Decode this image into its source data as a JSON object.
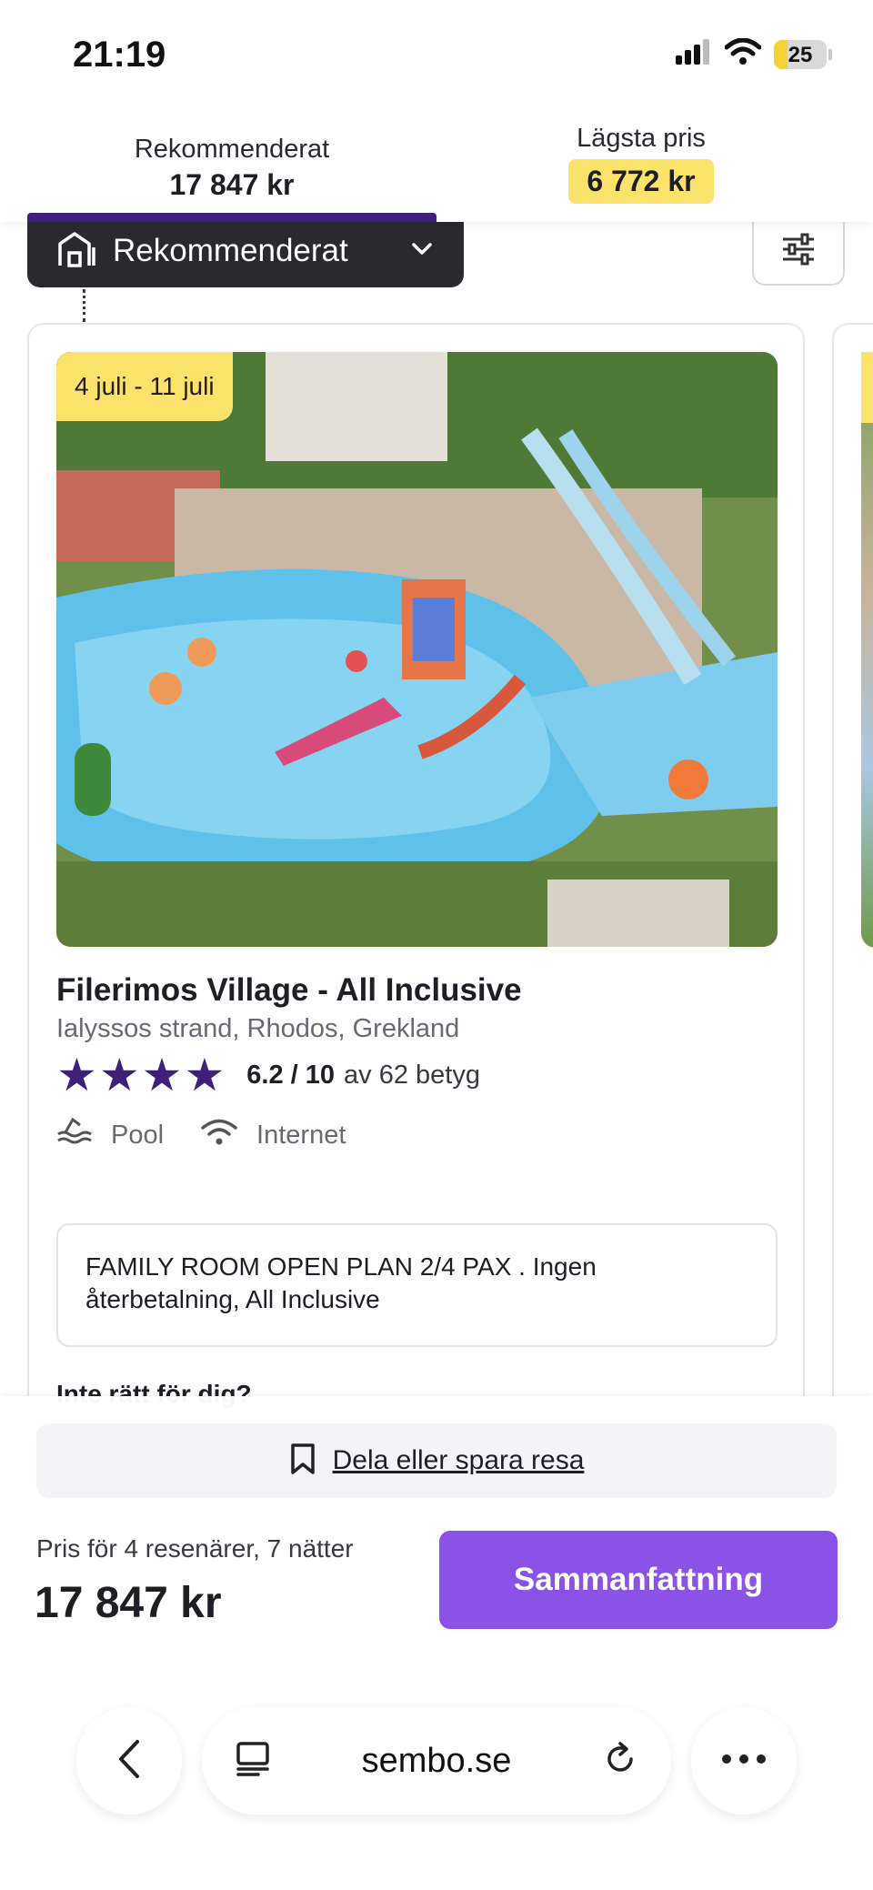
{
  "status_bar": {
    "time": "21:19",
    "battery": "25",
    "battery_level": 0.25
  },
  "sort_tabs": [
    {
      "label": "Rekommenderat",
      "price": "17 847 kr"
    },
    {
      "label": "Lägsta pris",
      "price": "6 772 kr"
    }
  ],
  "sort_dropdown": {
    "label": "Rekommenderat"
  },
  "hotel": {
    "dates": "4 juli - 11 juli",
    "name": "Filerimos Village - All Inclusive",
    "location": "Ialyssos strand, Rhodos, Grekland",
    "stars": "★★★★",
    "star_count": 4,
    "score": "6.2 / 10",
    "review_count": "av 62 betyg",
    "amenities": [
      "Pool",
      "Internet"
    ],
    "room": "FAMILY ROOM OPEN PLAN 2/4 PAX . Ingen återbetalning, All Inclusive",
    "not_right": "Inte rätt för dig?"
  },
  "bottom": {
    "share_label": "Dela eller spara resa",
    "price_caption": "Pris för 4 resenärer, 7 nätter",
    "price_total": "17 847 kr",
    "summary_button": "Sammanfattning"
  },
  "browser": {
    "url": "sembo.se"
  },
  "colors": {
    "accent_purple": "#8b52e8",
    "brand_dark_purple": "#3e1f7a",
    "highlight_yellow": "#fbe36b",
    "dark_button": "#2a2a2e"
  }
}
